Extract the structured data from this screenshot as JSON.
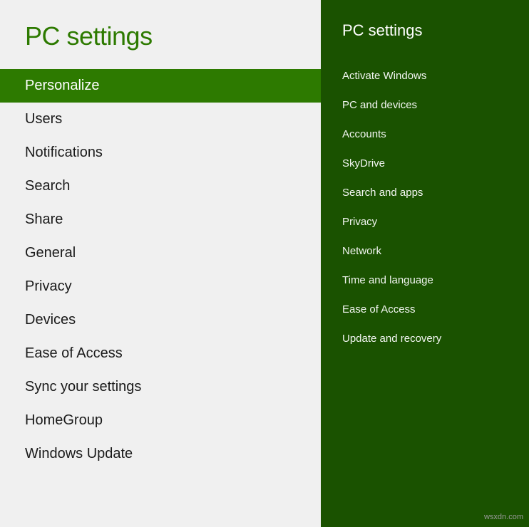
{
  "left": {
    "title": "PC settings",
    "nav_items": [
      {
        "label": "Personalize",
        "active": true
      },
      {
        "label": "Users",
        "active": false
      },
      {
        "label": "Notifications",
        "active": false
      },
      {
        "label": "Search",
        "active": false
      },
      {
        "label": "Share",
        "active": false
      },
      {
        "label": "General",
        "active": false
      },
      {
        "label": "Privacy",
        "active": false
      },
      {
        "label": "Devices",
        "active": false
      },
      {
        "label": "Ease of Access",
        "active": false
      },
      {
        "label": "Sync your settings",
        "active": false
      },
      {
        "label": "HomeGroup",
        "active": false
      },
      {
        "label": "Windows Update",
        "active": false
      }
    ]
  },
  "right": {
    "title": "PC settings",
    "nav_items": [
      {
        "label": "Activate Windows"
      },
      {
        "label": "PC and devices"
      },
      {
        "label": "Accounts"
      },
      {
        "label": "SkyDrive"
      },
      {
        "label": "Search and apps"
      },
      {
        "label": "Privacy"
      },
      {
        "label": "Network"
      },
      {
        "label": "Time and language"
      },
      {
        "label": "Ease of Access"
      },
      {
        "label": "Update and recovery"
      }
    ]
  },
  "watermark": "wsxdn.com"
}
